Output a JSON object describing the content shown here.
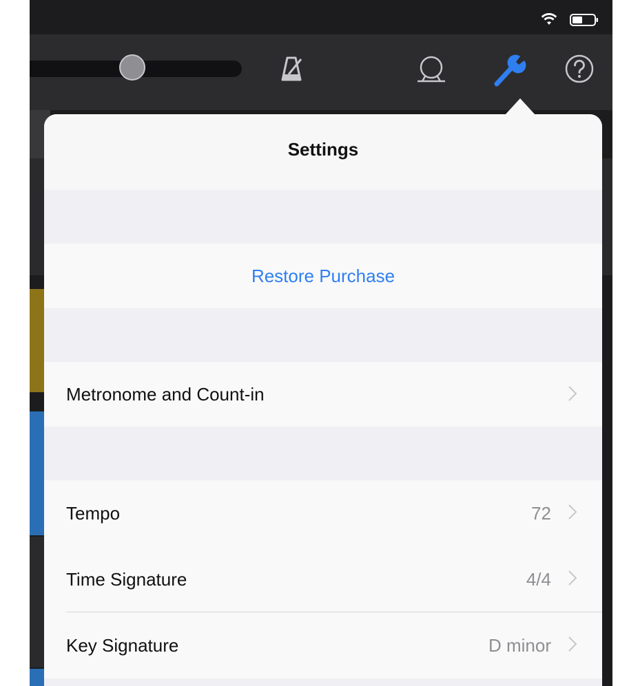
{
  "settings": {
    "title": "Settings",
    "restore_label": "Restore Purchase",
    "metronome_label": "Metronome and Count-in",
    "tempo_label": "Tempo",
    "tempo_value": "72",
    "time_signature_label": "Time Signature",
    "time_signature_value": "4/4",
    "key_signature_label": "Key Signature",
    "key_signature_value": "D minor"
  },
  "toolbar": {
    "icons": [
      "metronome-icon",
      "loop-icon",
      "wrench-icon",
      "help-icon"
    ],
    "active_icon": "wrench-icon"
  },
  "status_bar": {
    "icons": [
      "wifi-icon",
      "battery-icon"
    ]
  },
  "colors": {
    "accent": "#2f7ff0",
    "toolbar_bg": "#2c2c2e",
    "popover_bg": "#f7f7f7",
    "group_bg": "#efeff4",
    "secondary_text": "#8e8e93"
  }
}
